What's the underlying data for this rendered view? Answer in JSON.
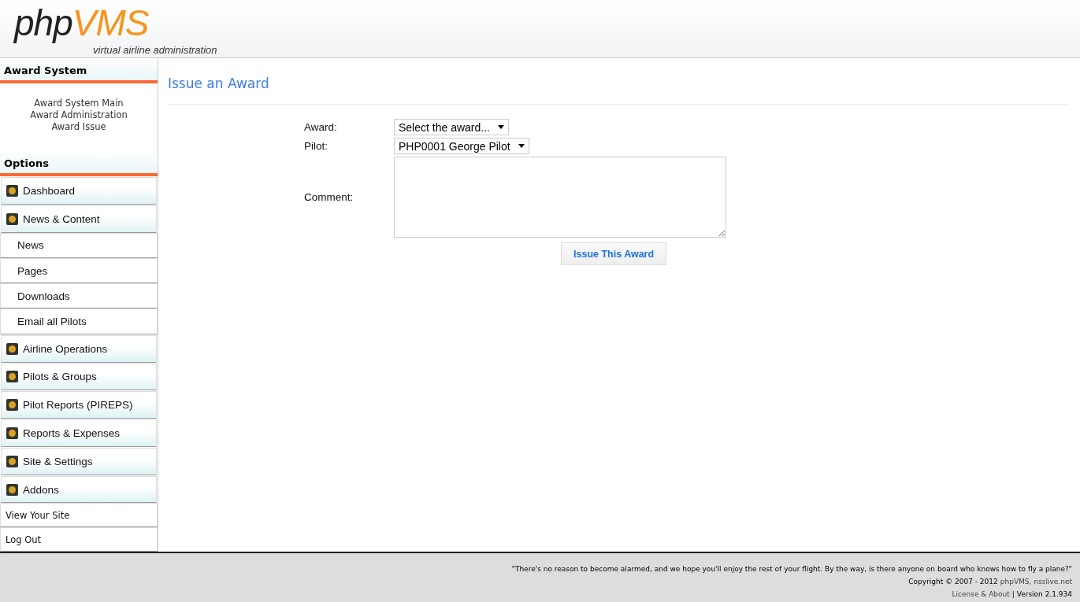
{
  "logo": {
    "part1": "php",
    "part2": "VMS",
    "tagline": "virtual airline administration"
  },
  "sidebar": {
    "award_title": "Award System",
    "award_links": [
      "Award System Main",
      "Award Administration",
      "Award Issue"
    ],
    "options_title": "Options",
    "items": [
      {
        "label": "Dashboard",
        "kind": "section"
      },
      {
        "label": "News & Content",
        "kind": "section"
      },
      {
        "label": "News",
        "kind": "sub"
      },
      {
        "label": "Pages",
        "kind": "sub"
      },
      {
        "label": "Downloads",
        "kind": "sub"
      },
      {
        "label": "Email all Pilots",
        "kind": "sub"
      },
      {
        "label": "Airline Operations",
        "kind": "section"
      },
      {
        "label": "Pilots & Groups",
        "kind": "section"
      },
      {
        "label": "Pilot Reports (PIREPS)",
        "kind": "section"
      },
      {
        "label": "Reports & Expenses",
        "kind": "section"
      },
      {
        "label": "Site & Settings",
        "kind": "section"
      },
      {
        "label": "Addons",
        "kind": "section"
      },
      {
        "label": "View Your Site",
        "kind": "link"
      },
      {
        "label": "Log Out",
        "kind": "link"
      }
    ]
  },
  "page": {
    "title": "Issue an Award",
    "form": {
      "award_label": "Award:",
      "award_value": "Select the award...",
      "pilot_label": "Pilot:",
      "pilot_value": "PHP0001 George Pilot",
      "comment_label": "Comment:",
      "submit": "Issue This Award"
    }
  },
  "footer": {
    "quote": "\"There's no reason to become alarmed, and we hope you'll enjoy the rest of your flight. By the way, is there anyone on board who knows how to fly a plane?\"",
    "copyright": "Copyright © 2007 - 2012",
    "links": [
      "phpVMS,",
      "nsslive.net"
    ],
    "about_link": "License & About",
    "version": "| Version 2.1.934"
  }
}
